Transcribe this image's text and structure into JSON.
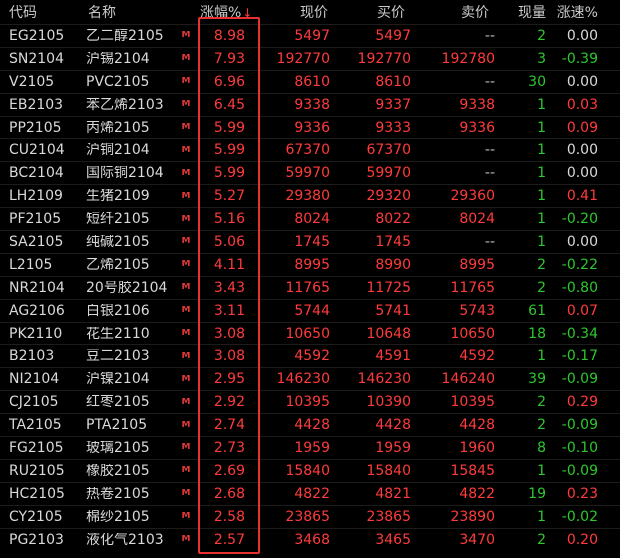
{
  "headers": {
    "code": "代码",
    "name": "名称",
    "pct": "涨幅%",
    "pct_sort_icon": "↓",
    "price": "现价",
    "bid": "买价",
    "ask": "卖价",
    "vol": "现量",
    "speed": "涨速%"
  },
  "colors": {
    "up": "#ff3b3b",
    "down": "#2ec72e",
    "highlight": "#e8322f",
    "background": "#000000"
  },
  "rows": [
    {
      "code": "EG2105",
      "name": "乙二醇2105",
      "flag": "M",
      "pct": "8.98",
      "price": "5497",
      "bid": "5497",
      "ask": "--",
      "vol": "2",
      "speed": "0.00"
    },
    {
      "code": "SN2104",
      "name": "沪锡2104",
      "flag": "M",
      "pct": "7.93",
      "price": "192770",
      "bid": "192770",
      "ask": "192780",
      "vol": "3",
      "speed": "-0.39"
    },
    {
      "code": "V2105",
      "name": "PVC2105",
      "flag": "M",
      "pct": "6.96",
      "price": "8610",
      "bid": "8610",
      "ask": "--",
      "vol": "30",
      "speed": "0.00"
    },
    {
      "code": "EB2103",
      "name": "苯乙烯2103",
      "flag": "M",
      "pct": "6.45",
      "price": "9338",
      "bid": "9337",
      "ask": "9338",
      "vol": "1",
      "speed": "0.03"
    },
    {
      "code": "PP2105",
      "name": "丙烯2105",
      "flag": "M",
      "pct": "5.99",
      "price": "9336",
      "bid": "9333",
      "ask": "9336",
      "vol": "1",
      "speed": "0.09"
    },
    {
      "code": "CU2104",
      "name": "沪铜2104",
      "flag": "M",
      "pct": "5.99",
      "price": "67370",
      "bid": "67370",
      "ask": "--",
      "vol": "1",
      "speed": "0.00"
    },
    {
      "code": "BC2104",
      "name": "国际铜2104",
      "flag": "M",
      "pct": "5.99",
      "price": "59970",
      "bid": "59970",
      "ask": "--",
      "vol": "1",
      "speed": "0.00"
    },
    {
      "code": "LH2109",
      "name": "生猪2109",
      "flag": "M",
      "pct": "5.27",
      "price": "29380",
      "bid": "29320",
      "ask": "29360",
      "vol": "1",
      "speed": "0.41"
    },
    {
      "code": "PF2105",
      "name": "短纤2105",
      "flag": "M",
      "pct": "5.16",
      "price": "8024",
      "bid": "8022",
      "ask": "8024",
      "vol": "1",
      "speed": "-0.20"
    },
    {
      "code": "SA2105",
      "name": "纯碱2105",
      "flag": "M",
      "pct": "5.06",
      "price": "1745",
      "bid": "1745",
      "ask": "--",
      "vol": "1",
      "speed": "0.00"
    },
    {
      "code": "L2105",
      "name": "乙烯2105",
      "flag": "M",
      "pct": "4.11",
      "price": "8995",
      "bid": "8990",
      "ask": "8995",
      "vol": "2",
      "speed": "-0.22"
    },
    {
      "code": "NR2104",
      "name": "20号胶2104",
      "flag": "M",
      "pct": "3.43",
      "price": "11765",
      "bid": "11725",
      "ask": "11765",
      "vol": "2",
      "speed": "-0.80"
    },
    {
      "code": "AG2106",
      "name": "白银2106",
      "flag": "M",
      "pct": "3.11",
      "price": "5744",
      "bid": "5741",
      "ask": "5743",
      "vol": "61",
      "speed": "0.07"
    },
    {
      "code": "PK2110",
      "name": "花生2110",
      "flag": "M",
      "pct": "3.08",
      "price": "10650",
      "bid": "10648",
      "ask": "10650",
      "vol": "18",
      "speed": "-0.34"
    },
    {
      "code": "B2103",
      "name": "豆二2103",
      "flag": "M",
      "pct": "3.08",
      "price": "4592",
      "bid": "4591",
      "ask": "4592",
      "vol": "1",
      "speed": "-0.17"
    },
    {
      "code": "NI2104",
      "name": "沪镍2104",
      "flag": "M",
      "pct": "2.95",
      "price": "146230",
      "bid": "146230",
      "ask": "146240",
      "vol": "39",
      "speed": "-0.09"
    },
    {
      "code": "CJ2105",
      "name": "红枣2105",
      "flag": "M",
      "pct": "2.92",
      "price": "10395",
      "bid": "10390",
      "ask": "10395",
      "vol": "2",
      "speed": "0.29"
    },
    {
      "code": "TA2105",
      "name": "PTA2105",
      "flag": "M",
      "pct": "2.74",
      "price": "4428",
      "bid": "4428",
      "ask": "4428",
      "vol": "2",
      "speed": "-0.09"
    },
    {
      "code": "FG2105",
      "name": "玻璃2105",
      "flag": "M",
      "pct": "2.73",
      "price": "1959",
      "bid": "1959",
      "ask": "1960",
      "vol": "8",
      "speed": "-0.10"
    },
    {
      "code": "RU2105",
      "name": "橡胶2105",
      "flag": "M",
      "pct": "2.69",
      "price": "15840",
      "bid": "15840",
      "ask": "15845",
      "vol": "1",
      "speed": "-0.09"
    },
    {
      "code": "HC2105",
      "name": "热卷2105",
      "flag": "M",
      "pct": "2.68",
      "price": "4822",
      "bid": "4821",
      "ask": "4822",
      "vol": "19",
      "speed": "0.23"
    },
    {
      "code": "CY2105",
      "name": "棉纱2105",
      "flag": "M",
      "pct": "2.58",
      "price": "23865",
      "bid": "23865",
      "ask": "23890",
      "vol": "1",
      "speed": "-0.02"
    },
    {
      "code": "PG2103",
      "name": "液化气2103",
      "flag": "M",
      "pct": "2.57",
      "price": "3468",
      "bid": "3465",
      "ask": "3470",
      "vol": "2",
      "speed": "0.20"
    }
  ]
}
